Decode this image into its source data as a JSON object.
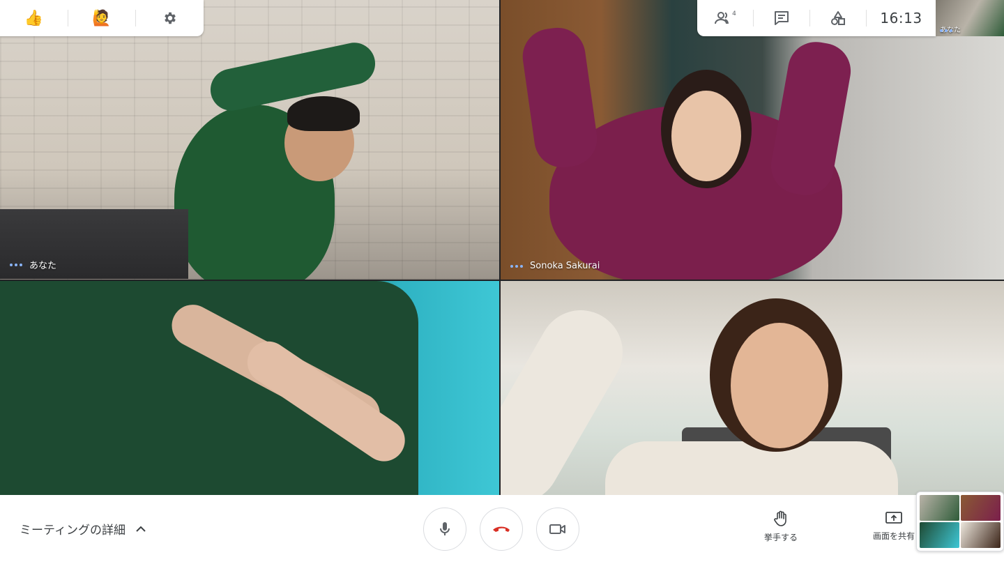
{
  "toolbar_left": {
    "items": [
      {
        "icon": "thumbs-up-icon",
        "glyph": "👍"
      },
      {
        "icon": "raise-hand-person-icon",
        "glyph": "🙋"
      },
      {
        "icon": "gear-icon",
        "glyph": "⚙"
      }
    ]
  },
  "toolbar_right": {
    "participants_count": "4",
    "clock": "16:13",
    "self_view_label": "あなた"
  },
  "tiles": [
    {
      "name": "あなた"
    },
    {
      "name": "Sonoka Sakurai"
    },
    {
      "name": ""
    },
    {
      "name": ""
    }
  ],
  "bottom": {
    "meeting_details": "ミーティングの詳細",
    "raise_hand_label": "挙手する",
    "share_screen_label": "画面を共有"
  },
  "colors": {
    "accent_blue": "#8ab4f8",
    "hangup_red": "#d93025",
    "icon_gray": "#5f6368"
  }
}
